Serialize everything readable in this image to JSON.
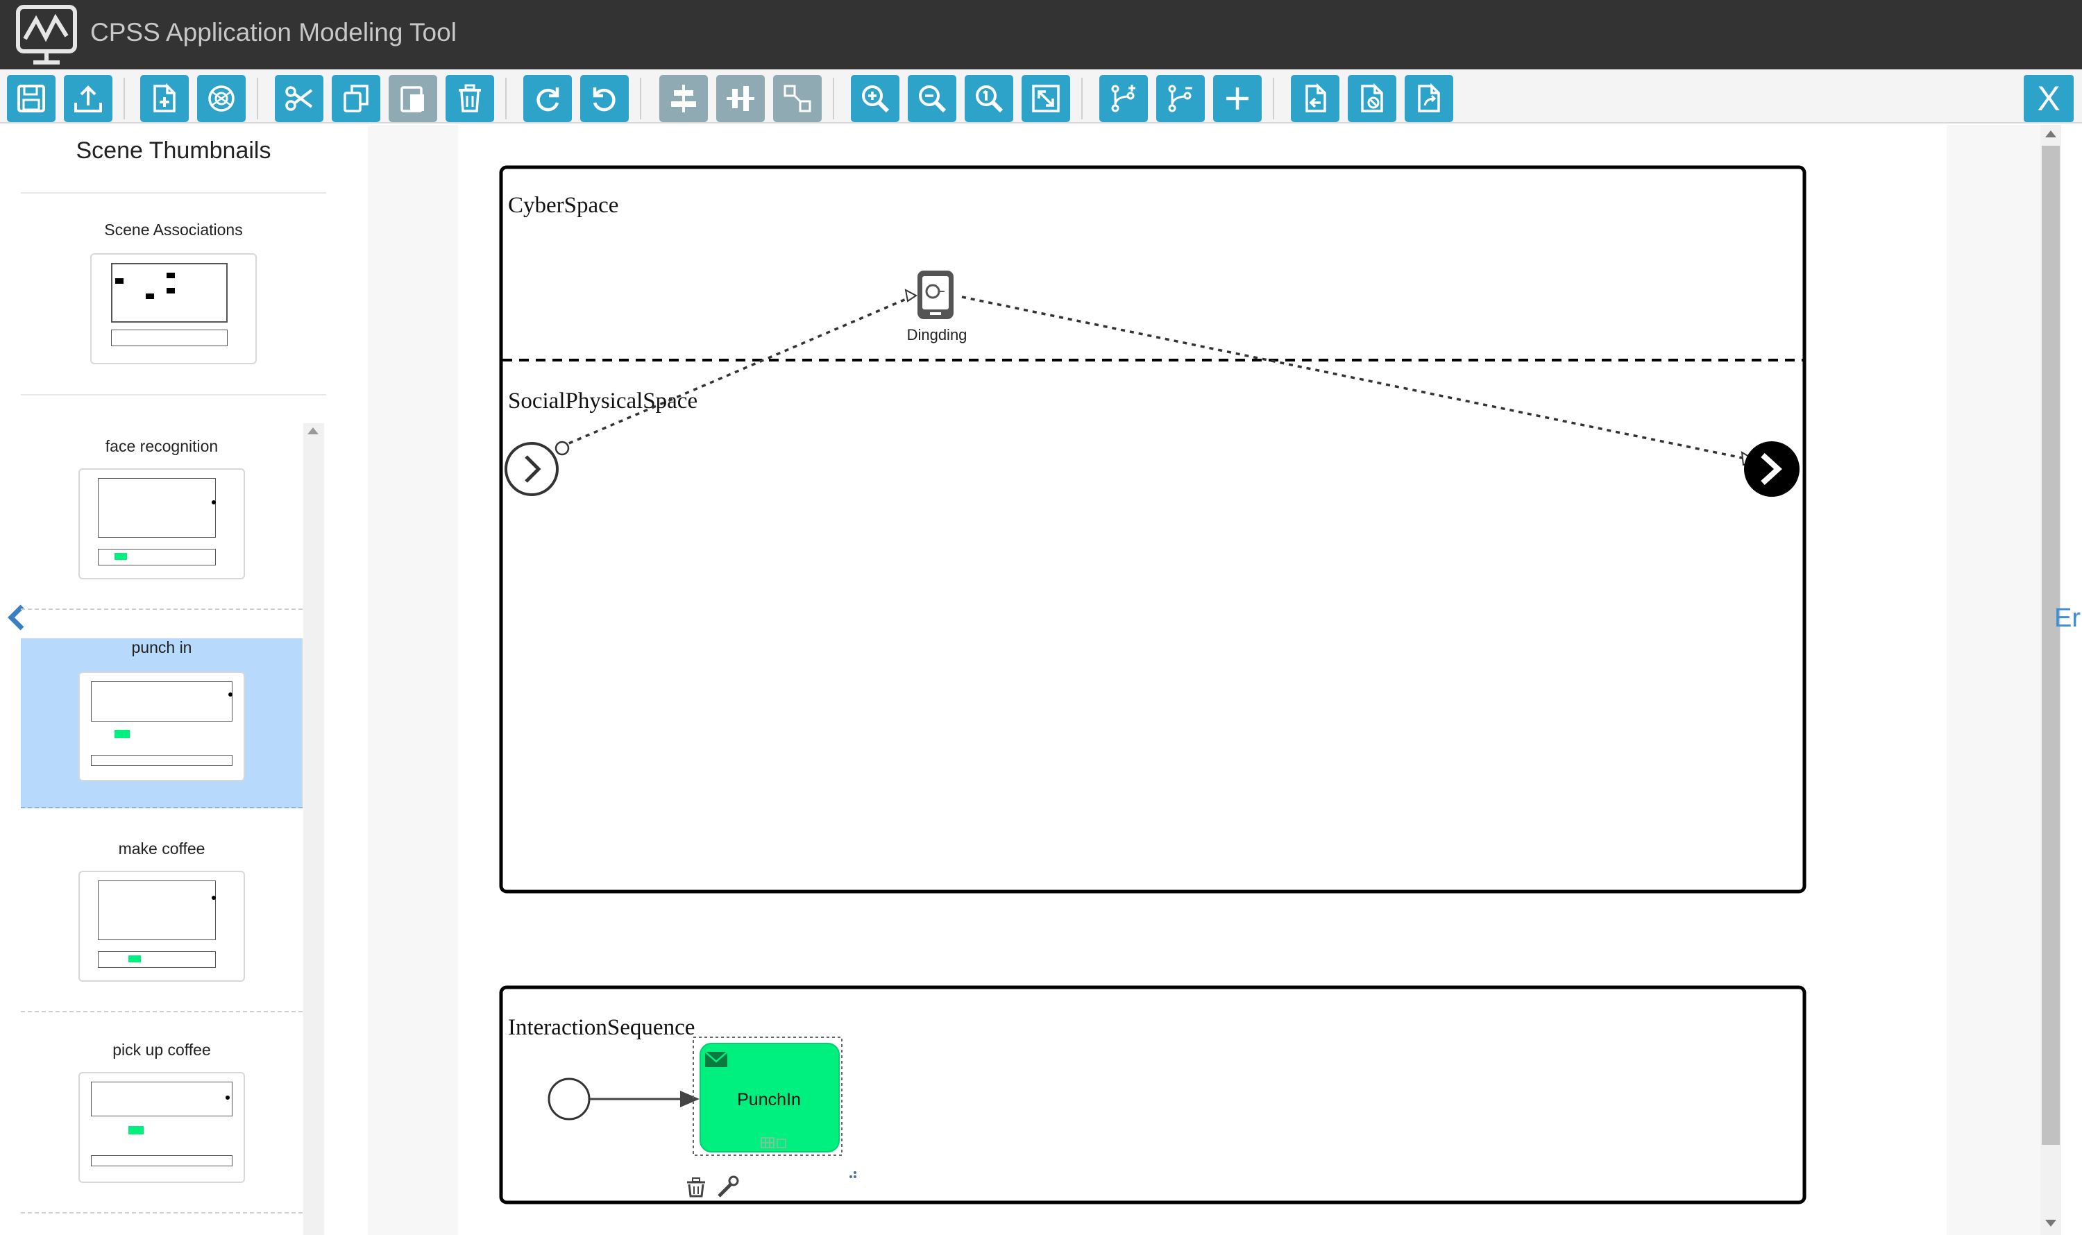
{
  "app": {
    "title": "CPSS Application Modeling Tool",
    "close_label": "X"
  },
  "toolbar": {
    "buttons": [
      {
        "name": "save-button",
        "icon": "save-icon"
      },
      {
        "name": "upload-button",
        "icon": "upload-icon"
      },
      {
        "name": "new-scene-button",
        "icon": "new-file-icon"
      },
      {
        "name": "network-button",
        "icon": "network-icon"
      },
      {
        "name": "cut-button",
        "icon": "scissors-icon"
      },
      {
        "name": "copy-button",
        "icon": "copy-icon"
      },
      {
        "name": "paste-button",
        "icon": "paste-icon"
      },
      {
        "name": "delete-button",
        "icon": "trash-icon"
      },
      {
        "name": "redo-button",
        "icon": "redo-icon"
      },
      {
        "name": "undo-button",
        "icon": "undo-icon"
      },
      {
        "name": "align-horizontal-button",
        "icon": "align-h-icon"
      },
      {
        "name": "align-vertical-button",
        "icon": "align-v-icon"
      },
      {
        "name": "resize-button",
        "icon": "resize-icon"
      },
      {
        "name": "zoom-in-button",
        "icon": "zoom-in-icon"
      },
      {
        "name": "zoom-out-button",
        "icon": "zoom-out-icon"
      },
      {
        "name": "zoom-actual-button",
        "icon": "zoom-reset-icon"
      },
      {
        "name": "fit-button",
        "icon": "fit-icon"
      },
      {
        "name": "add-branch-button",
        "icon": "branch-add-icon"
      },
      {
        "name": "remove-branch-button",
        "icon": "branch-remove-icon"
      },
      {
        "name": "add-button",
        "icon": "plus-icon"
      },
      {
        "name": "import-button",
        "icon": "import-icon"
      },
      {
        "name": "clear-button",
        "icon": "clear-file-icon"
      },
      {
        "name": "export-button",
        "icon": "export-icon"
      }
    ]
  },
  "sidebar": {
    "title": "Scene Thumbnails",
    "associations_label": "Scene Associations",
    "scenes": [
      {
        "label": "face recognition"
      },
      {
        "label": "punch in",
        "selected": true
      },
      {
        "label": "make coffee"
      },
      {
        "label": "pick up coffee"
      }
    ]
  },
  "diagram": {
    "pool": {
      "lanes": [
        "CyberSpace",
        "SocialPhysicalSpace"
      ]
    },
    "device_label": "Dingding",
    "sequence_title": "InteractionSequence",
    "task_label": "PunchIn",
    "peek_text": "Er"
  },
  "colors": {
    "titlebar": "#333333",
    "toolbar_button": "#2ea3c9",
    "toolbar_button_disabled": "#8faab2",
    "selected_thumb": "#b7d9fb",
    "task_fill": "#00f080"
  }
}
